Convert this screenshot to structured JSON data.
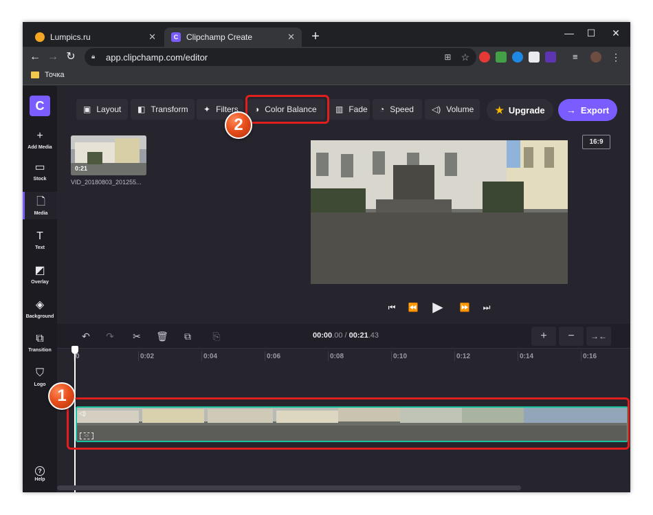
{
  "browser": {
    "tabs": [
      {
        "title": "Lumpics.ru",
        "favicon_color": "#f5a623"
      },
      {
        "title": "Clipchamp Create",
        "favicon_letter": "C"
      }
    ],
    "new_tab_label": "+",
    "url": "app.clipchamp.com/editor",
    "bookmarks": [
      {
        "label": "Точка"
      }
    ],
    "window_controls": [
      "minimize",
      "maximize",
      "close"
    ]
  },
  "app": {
    "logo_letter": "C",
    "nav": [
      {
        "label": "Add Media",
        "icon": "plus-icon",
        "glyph": "+"
      },
      {
        "label": "Stock",
        "icon": "stock-icon",
        "glyph": "▭"
      },
      {
        "label": "Media",
        "icon": "file-icon",
        "glyph": "🗋"
      },
      {
        "label": "Text",
        "icon": "text-icon",
        "glyph": "T"
      },
      {
        "label": "Overlay",
        "icon": "overlay-icon",
        "glyph": "◩"
      },
      {
        "label": "Background",
        "icon": "layers-icon",
        "glyph": "◈"
      },
      {
        "label": "Transition",
        "icon": "transition-icon",
        "glyph": "⧉"
      },
      {
        "label": "Logo",
        "icon": "shield-icon",
        "glyph": "⛉"
      },
      {
        "label": "Help",
        "icon": "help-icon",
        "glyph": "?"
      }
    ],
    "tools": [
      {
        "label": "Layout",
        "icon": "layout-icon",
        "glyph": "▣"
      },
      {
        "label": "Transform",
        "icon": "transform-icon",
        "glyph": "◧"
      },
      {
        "label": "Filters",
        "icon": "sparkle-icon",
        "glyph": "✦"
      },
      {
        "label": "Color Balance",
        "icon": "color-balance-icon",
        "glyph": "◑"
      },
      {
        "label": "Fade",
        "icon": "fade-icon",
        "glyph": "▥"
      },
      {
        "label": "Speed",
        "icon": "speed-icon",
        "glyph": "◔"
      },
      {
        "label": "Volume",
        "icon": "volume-icon",
        "glyph": "◁)"
      }
    ],
    "upgrade_label": "Upgrade",
    "export_label": "Export",
    "aspect_ratio": "16:9",
    "media": {
      "duration": "0:21",
      "filename": "VID_20180803_201255..."
    },
    "timeline": {
      "time_current": "00:00",
      "time_current_frac": ".00",
      "time_sep": " / ",
      "time_total": "00:21",
      "time_total_frac": ".43",
      "ticks": [
        "0",
        "0:02",
        "0:04",
        "0:06",
        "0:08",
        "0:10",
        "0:12",
        "0:14",
        "0:16"
      ]
    },
    "annotations": {
      "step1": "1",
      "step2": "2"
    }
  }
}
